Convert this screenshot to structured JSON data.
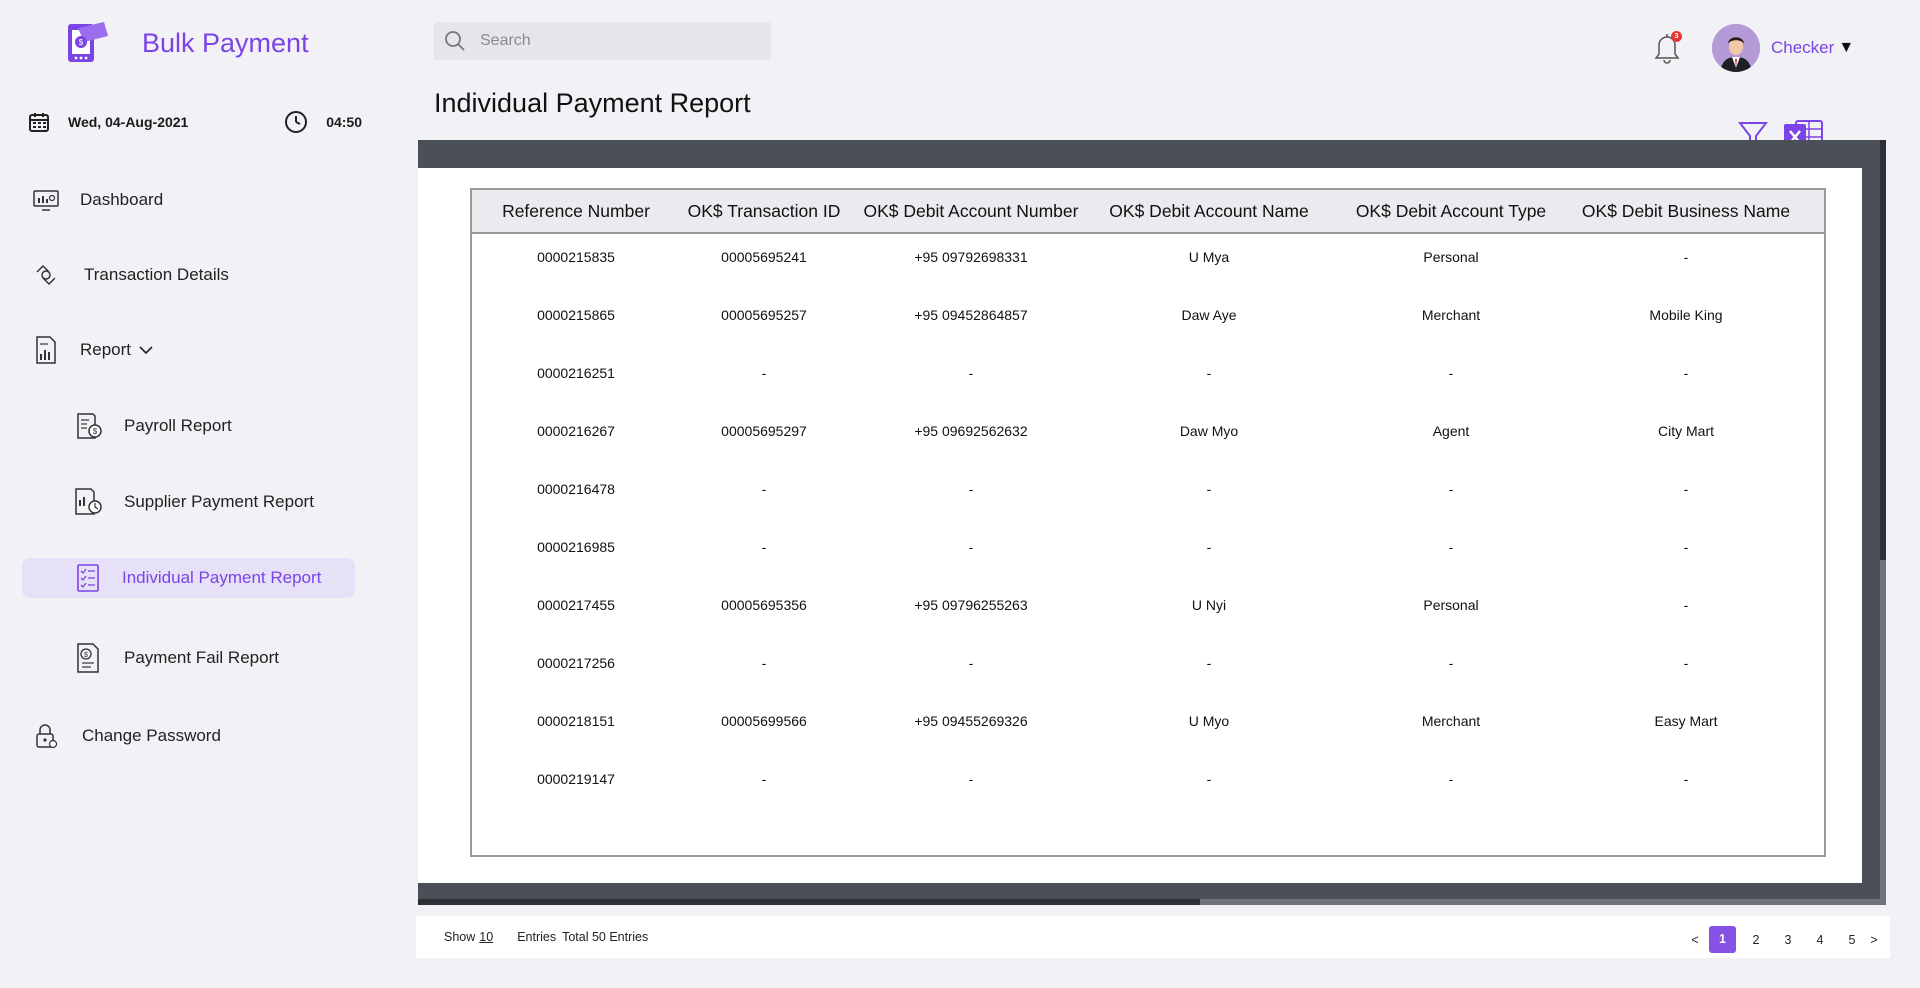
{
  "app": {
    "title": "Bulk Payment"
  },
  "datetime": {
    "date": "Wed, 04-Aug-2021",
    "time": "04:50"
  },
  "sidebar": {
    "items": [
      {
        "label": "Dashboard",
        "icon": "dashboard-icon"
      },
      {
        "label": "Transaction Details",
        "icon": "transaction-icon"
      },
      {
        "label": "Report",
        "icon": "report-icon",
        "expanded": true
      },
      {
        "label": "Payroll Report",
        "icon": "payroll-icon"
      },
      {
        "label": "Supplier Payment Report",
        "icon": "supplier-report-icon"
      },
      {
        "label": "Individual Payment Report",
        "icon": "individual-report-icon",
        "active": true
      },
      {
        "label": "Payment Fail Report",
        "icon": "payment-fail-icon"
      },
      {
        "label": "Change Password",
        "icon": "lock-icon"
      }
    ]
  },
  "header": {
    "search_placeholder": "Search",
    "notification_count": "3",
    "user_name": "Checker"
  },
  "page": {
    "title": "Individual Payment Report"
  },
  "table": {
    "columns": [
      "Reference Number",
      "OK$ Transaction ID",
      "OK$ Debit Account Number",
      "OK$ Debit Account Name",
      "OK$ Debit Account Type",
      "OK$ Debit Business Name"
    ],
    "rows": [
      [
        "0000215835",
        "00005695241",
        "+95 09792698331",
        "U Mya",
        "Personal",
        "-"
      ],
      [
        "0000215865",
        "00005695257",
        "+95 09452864857",
        "Daw Aye",
        "Merchant",
        "Mobile King"
      ],
      [
        "0000216251",
        "-",
        "-",
        "-",
        "-",
        "-"
      ],
      [
        "0000216267",
        "00005695297",
        "+95 09692562632",
        "Daw Myo",
        "Agent",
        "City Mart"
      ],
      [
        "0000216478",
        "-",
        "-",
        "-",
        "-",
        "-"
      ],
      [
        "0000216985",
        "-",
        "-",
        "-",
        "-",
        "-"
      ],
      [
        "0000217455",
        "00005695356",
        "+95 09796255263",
        "U Nyi",
        "Personal",
        "-"
      ],
      [
        "0000217256",
        "-",
        "-",
        "-",
        "-",
        "-"
      ],
      [
        "0000218151",
        "00005699566",
        "+95 09455269326",
        "U Myo",
        "Merchant",
        "Easy Mart"
      ],
      [
        "0000219147",
        "-",
        "-",
        "-",
        "-",
        "-"
      ]
    ]
  },
  "footer": {
    "show_label": "Show",
    "show_value": "10",
    "entries_label": "Entries",
    "total_label": "Total 50 Entries",
    "pages": [
      "1",
      "2",
      "3",
      "4",
      "5"
    ],
    "current_page": "1",
    "prev": "<",
    "next": ">"
  },
  "colors": {
    "accent": "#7a44e6",
    "active_bg": "#e6e1f7"
  }
}
